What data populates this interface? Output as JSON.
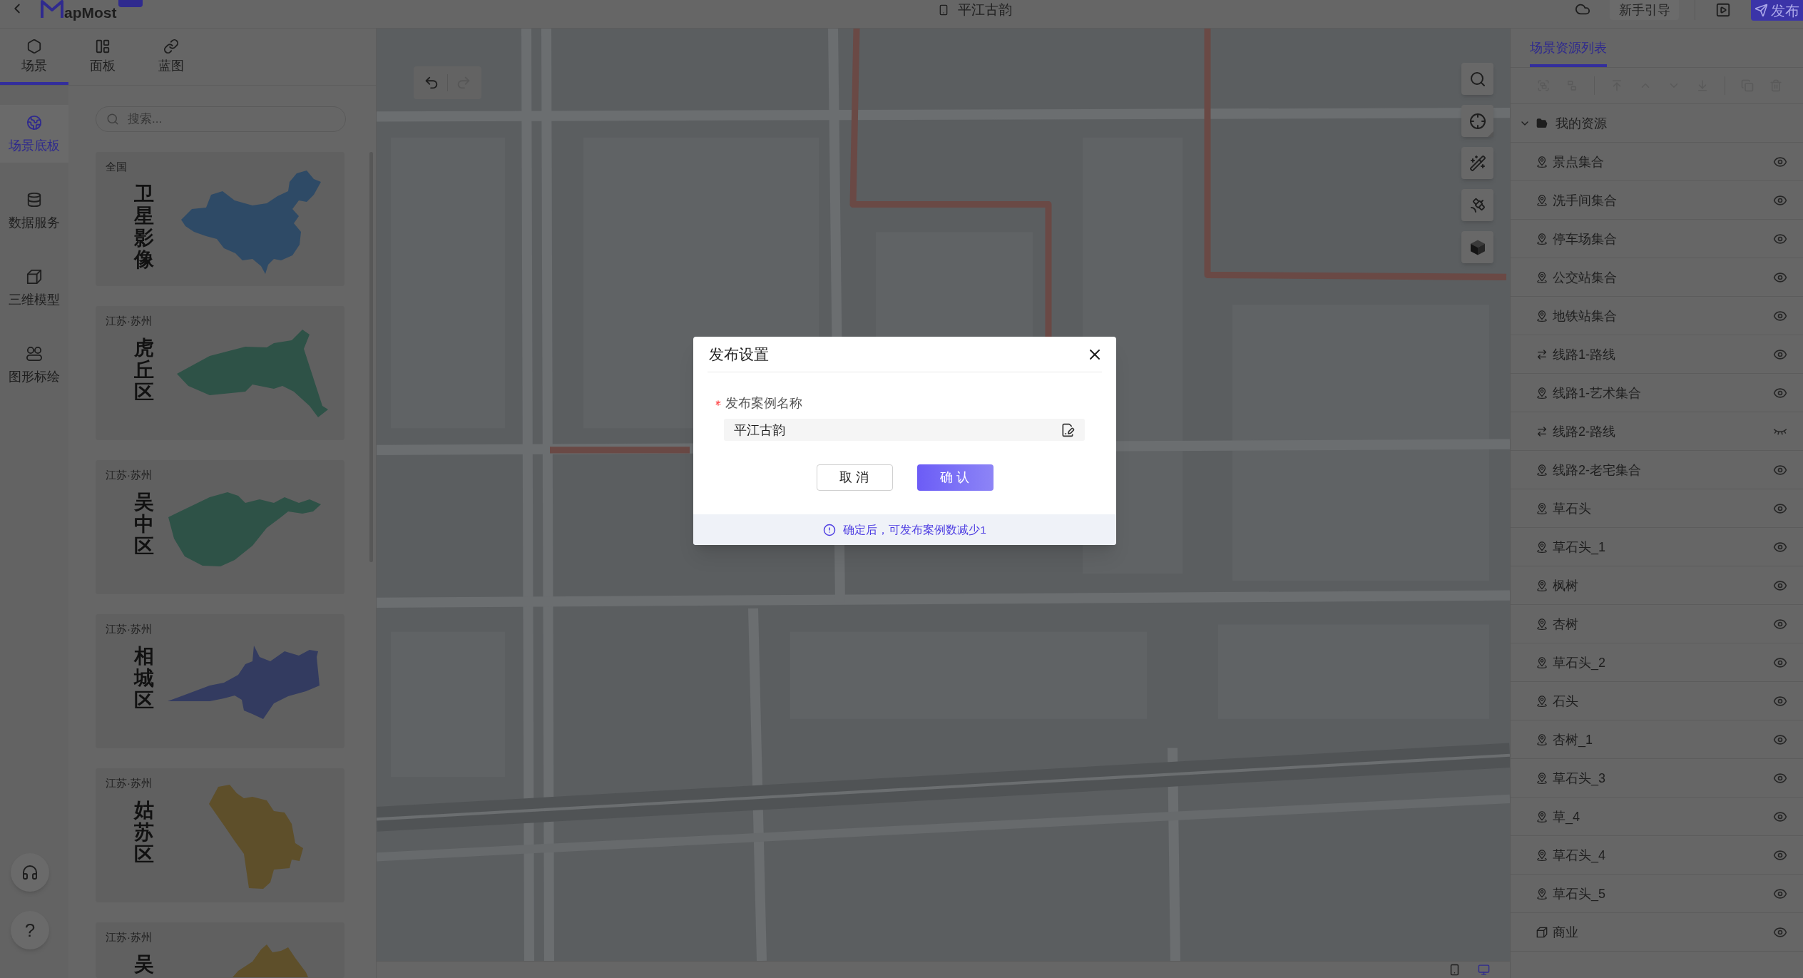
{
  "top_bar": {
    "logo_text": "apMost",
    "title": "平江古韵",
    "guide_button": "新手引导",
    "publish_button": "发布"
  },
  "left_tabs": [
    {
      "label": "场景",
      "kind": "scene",
      "selected": true
    },
    {
      "label": "面板",
      "kind": "panel",
      "selected": false
    },
    {
      "label": "蓝图",
      "kind": "blueprint",
      "selected": false
    }
  ],
  "side_nav": [
    {
      "label": "场景底板",
      "kind": "globe",
      "selected": true
    },
    {
      "label": "数据服务",
      "kind": "database",
      "selected": false
    },
    {
      "label": "三维模型",
      "kind": "cube",
      "selected": false
    },
    {
      "label": "图形标绘",
      "kind": "shapes",
      "selected": false
    }
  ],
  "help_button": "?",
  "search": {
    "placeholder": "搜索..."
  },
  "base_maps": [
    {
      "region": "全国",
      "title": "卫星影像",
      "kind": "china",
      "color": "#2e4a66"
    },
    {
      "region": "江苏·苏州",
      "title": "虎丘区",
      "kind": "huqiu",
      "color": "#2e5247"
    },
    {
      "region": "江苏·苏州",
      "title": "吴中区",
      "kind": "wuzhong",
      "color": "#2e5247"
    },
    {
      "region": "江苏·苏州",
      "title": "相城区",
      "kind": "xiangcheng",
      "color": "#333b60"
    },
    {
      "region": "江苏·苏州",
      "title": "姑苏区",
      "kind": "gusu",
      "color": "#5e4f2a"
    },
    {
      "region": "江苏·苏州",
      "title": "吴",
      "kind": "wujiang",
      "color": "#5e4f2a"
    }
  ],
  "map_history": [
    {
      "kind": "undo",
      "disabled": false
    },
    {
      "kind": "redo",
      "disabled": true
    }
  ],
  "map_tools": [
    {
      "kind": "search"
    },
    {
      "kind": "locate"
    },
    {
      "kind": "magic_wand"
    },
    {
      "kind": "satellite"
    },
    {
      "kind": "cube"
    }
  ],
  "device_toggle": [
    {
      "kind": "phone",
      "selected": false
    },
    {
      "kind": "desktop",
      "selected": true
    }
  ],
  "dialog": {
    "title": "发布设置",
    "field": {
      "label": "发布案例名称",
      "required": true,
      "value": "平江古韵"
    },
    "buttons": [
      {
        "label": "取 消",
        "kind": "secondary"
      },
      {
        "label": "确 认",
        "kind": "primary"
      }
    ],
    "notice": "确定后，可发布案例数减少1"
  },
  "resource_panel": {
    "tabs": [
      {
        "label": "场景资源列表",
        "selected": true
      }
    ],
    "toolbar": [
      {
        "kind": "group",
        "disabled": true
      },
      {
        "kind": "ungroup",
        "disabled": true
      },
      {
        "kind": "separator"
      },
      {
        "kind": "top",
        "disabled": true
      },
      {
        "kind": "up",
        "disabled": true
      },
      {
        "kind": "down",
        "disabled": true
      },
      {
        "kind": "bottom",
        "disabled": true
      },
      {
        "kind": "separator"
      },
      {
        "kind": "copy",
        "disabled": true
      },
      {
        "kind": "delete",
        "disabled": true
      }
    ],
    "tree": {
      "label": "我的资源",
      "expanded": true,
      "children": [
        {
          "label": "景点集合",
          "kind": "marker",
          "visible": true
        },
        {
          "label": "洗手间集合",
          "kind": "marker",
          "visible": true
        },
        {
          "label": "停车场集合",
          "kind": "marker",
          "visible": true
        },
        {
          "label": "公交站集合",
          "kind": "marker",
          "visible": true
        },
        {
          "label": "地铁站集合",
          "kind": "marker",
          "visible": true
        },
        {
          "label": "线路1-路线",
          "kind": "route",
          "visible": true
        },
        {
          "label": "线路1-艺术集合",
          "kind": "marker",
          "visible": true
        },
        {
          "label": "线路2-路线",
          "kind": "route",
          "visible": false
        },
        {
          "label": "线路2-老宅集合",
          "kind": "marker",
          "visible": true
        },
        {
          "label": "草石头",
          "kind": "marker",
          "visible": true
        },
        {
          "label": "草石头_1",
          "kind": "marker",
          "visible": true
        },
        {
          "label": "枫树",
          "kind": "marker",
          "visible": true
        },
        {
          "label": "杏树",
          "kind": "marker",
          "visible": true
        },
        {
          "label": "草石头_2",
          "kind": "marker",
          "visible": true
        },
        {
          "label": "石头",
          "kind": "marker",
          "visible": true
        },
        {
          "label": "杏树_1",
          "kind": "marker",
          "visible": true
        },
        {
          "label": "草石头_3",
          "kind": "marker",
          "visible": true
        },
        {
          "label": "草_4",
          "kind": "marker",
          "visible": true
        },
        {
          "label": "草石头_4",
          "kind": "marker",
          "visible": true
        },
        {
          "label": "草石头_5",
          "kind": "marker",
          "visible": true
        },
        {
          "label": "商业",
          "kind": "model",
          "visible": true
        }
      ]
    }
  }
}
